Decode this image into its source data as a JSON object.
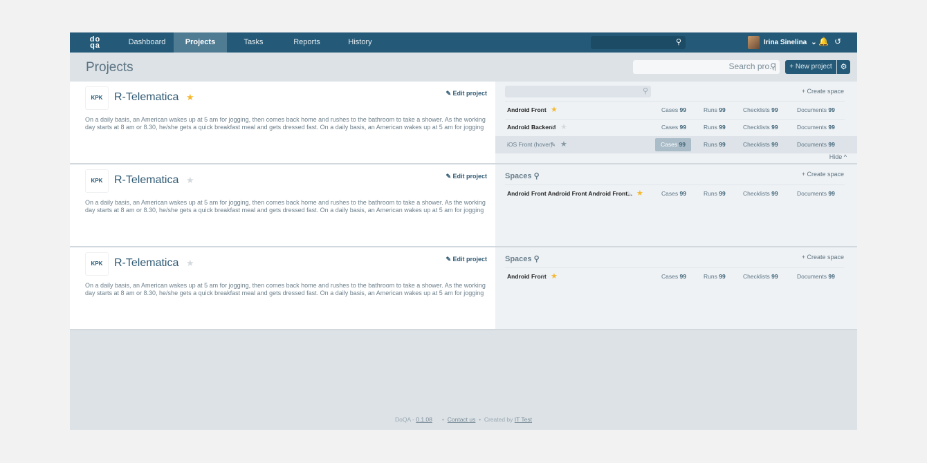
{
  "nav": {
    "logo": "do qa",
    "items": [
      "Dashboard",
      "Projects",
      "Tasks",
      "Reports",
      "History"
    ],
    "active": 1,
    "user": "Irina Sinelina"
  },
  "header": {
    "title": "Projects",
    "search_value": "Search pro..|",
    "new_project": "+  New project"
  },
  "projects": [
    {
      "logo": "KPK",
      "name": "R-Telematica",
      "starred": true,
      "edit": "Edit project",
      "desc": "On a daily basis, an American wakes up at 5 am for jogging, then comes back home and rushes to the bathroom to take a shower. As the working day starts at 8 am or 8.30, he/she gets a quick breakfast meal and gets dressed fast. On a daily basis, an American wakes up at 5 am for jogging",
      "spaces_label": null,
      "create": "+ Create space",
      "hide": "Hide ^",
      "spaces": [
        {
          "name": "Android Front",
          "starred": true,
          "cases": "99",
          "runs": "99",
          "checklists": "99",
          "documents": "99"
        },
        {
          "name": "Android Backend",
          "starred": false,
          "cases": "99",
          "runs": "99",
          "checklists": "99",
          "documents": "99"
        },
        {
          "name": "iOS Front (hover)",
          "starred": false,
          "hover": true,
          "cases": "99",
          "runs": "99",
          "checklists": "99",
          "documents": "99"
        }
      ]
    },
    {
      "logo": "KPK",
      "name": "R-Telematica",
      "starred": false,
      "edit": "Edit project",
      "desc": "On a daily basis, an American wakes up at 5 am for jogging, then comes back home and rushes to the bathroom to take a shower. As the working day starts at 8 am or 8.30, he/she gets a quick breakfast meal and gets dressed fast. On a daily basis, an American wakes up at 5 am for jogging",
      "spaces_label": "Spaces",
      "create": "+ Create space",
      "spaces": [
        {
          "name": "Android Front Android Front Android Front...",
          "starred": true,
          "cases": "99",
          "runs": "99",
          "checklists": "99",
          "documents": "99"
        }
      ]
    },
    {
      "logo": "KPK",
      "name": "R-Telematica",
      "starred": false,
      "edit": "Edit project",
      "desc": "On a daily basis, an American wakes up at 5 am for jogging, then comes back home and rushes to the bathroom to take a shower. As the working day starts at 8 am or 8.30, he/she gets a quick breakfast meal and gets dressed fast. On a daily basis, an American wakes up at 5 am for jogging",
      "spaces_label": "Spaces",
      "create": "+ Create space",
      "spaces": [
        {
          "name": "Android Front",
          "starred": true,
          "cases": "99",
          "runs": "99",
          "checklists": "99",
          "documents": "99"
        }
      ]
    }
  ],
  "labels": {
    "cases": "Cases",
    "runs": "Runs",
    "checklists": "Checklists",
    "documents": "Documents"
  },
  "footer": {
    "brand": "DoQA",
    "version": "0.1.08",
    "contact": "Contact us",
    "created_by": "Created by",
    "company": "IT Test"
  },
  "colors": {
    "nav": "#245a78",
    "star": "#f5b82e"
  }
}
